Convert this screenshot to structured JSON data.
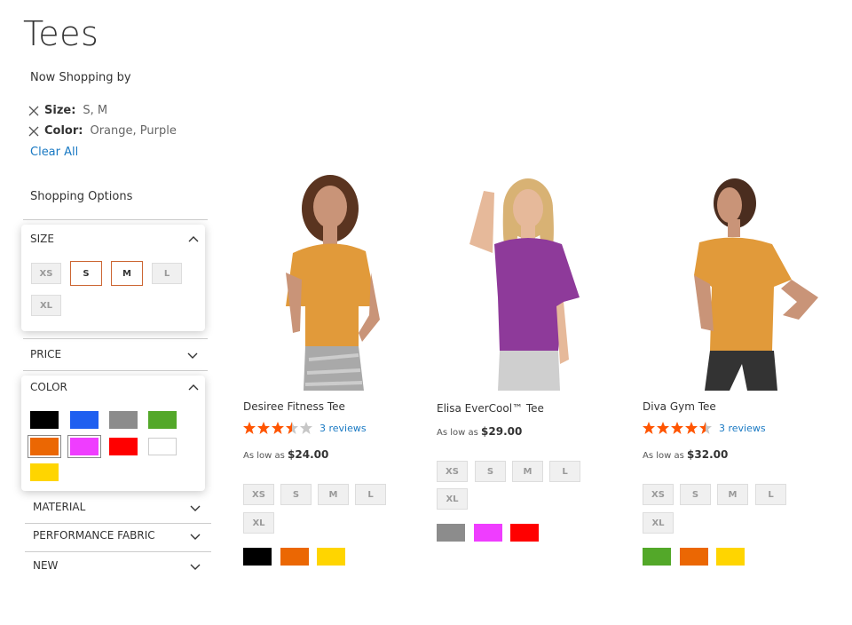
{
  "page": {
    "title": "Tees"
  },
  "now_shopping": {
    "title": "Now Shopping by",
    "filters": [
      {
        "label": "Size:",
        "value": "S, M"
      },
      {
        "label": "Color:",
        "value": "Orange, Purple"
      }
    ],
    "clear_all": "Clear All"
  },
  "shopping_options": {
    "title": "Shopping Options"
  },
  "sidebar": {
    "size": {
      "title": "SIZE",
      "options": [
        "XS",
        "S",
        "M",
        "L",
        "XL"
      ],
      "selected": [
        "S",
        "M"
      ]
    },
    "price": {
      "title": "PRICE"
    },
    "color": {
      "title": "COLOR",
      "swatches": [
        {
          "name": "Black",
          "hex": "#000000"
        },
        {
          "name": "Blue",
          "hex": "#1f5ff0"
        },
        {
          "name": "Gray",
          "hex": "#8c8c8c"
        },
        {
          "name": "Green",
          "hex": "#53a829"
        },
        {
          "name": "Orange",
          "hex": "#eb6703",
          "selected": true
        },
        {
          "name": "Purple",
          "hex": "#ef3dff",
          "selected": true
        },
        {
          "name": "Red",
          "hex": "#ff0000"
        },
        {
          "name": "White",
          "hex": "#ffffff"
        },
        {
          "name": "Yellow",
          "hex": "#ffd500"
        }
      ]
    },
    "material": {
      "title": "MATERIAL"
    },
    "performance": {
      "title": "PERFORMANCE FABRIC"
    },
    "new": {
      "title": "NEW"
    }
  },
  "products": [
    {
      "name": "Desiree Fitness Tee",
      "rating": 3.5,
      "reviews": "3 reviews",
      "price_prefix": "As low as",
      "price": "$24.00",
      "sizes": [
        "XS",
        "S",
        "M",
        "L",
        "XL"
      ],
      "colors": [
        "#000000",
        "#eb6703",
        "#ffd500"
      ],
      "shirt": "#e19a3a"
    },
    {
      "name": "Elisa EverCool™ Tee",
      "rating": null,
      "reviews": "",
      "price_prefix": "As low as",
      "price": "$29.00",
      "sizes": [
        "XS",
        "S",
        "M",
        "L",
        "XL"
      ],
      "colors": [
        "#8c8c8c",
        "#ef3dff",
        "#ff0000"
      ],
      "shirt": "#8e3a9a"
    },
    {
      "name": "Diva Gym Tee",
      "rating": 4.5,
      "reviews": "3 reviews",
      "price_prefix": "As low as",
      "price": "$32.00",
      "sizes": [
        "XS",
        "S",
        "M",
        "L",
        "XL"
      ],
      "colors": [
        "#53a829",
        "#eb6703",
        "#ffd500"
      ],
      "shirt": "#e19a3a"
    }
  ],
  "colors": {
    "accent": "#1979c3",
    "selected_border": "#cc6633",
    "star": "#ff5501",
    "star_empty": "#c7c7c7"
  }
}
